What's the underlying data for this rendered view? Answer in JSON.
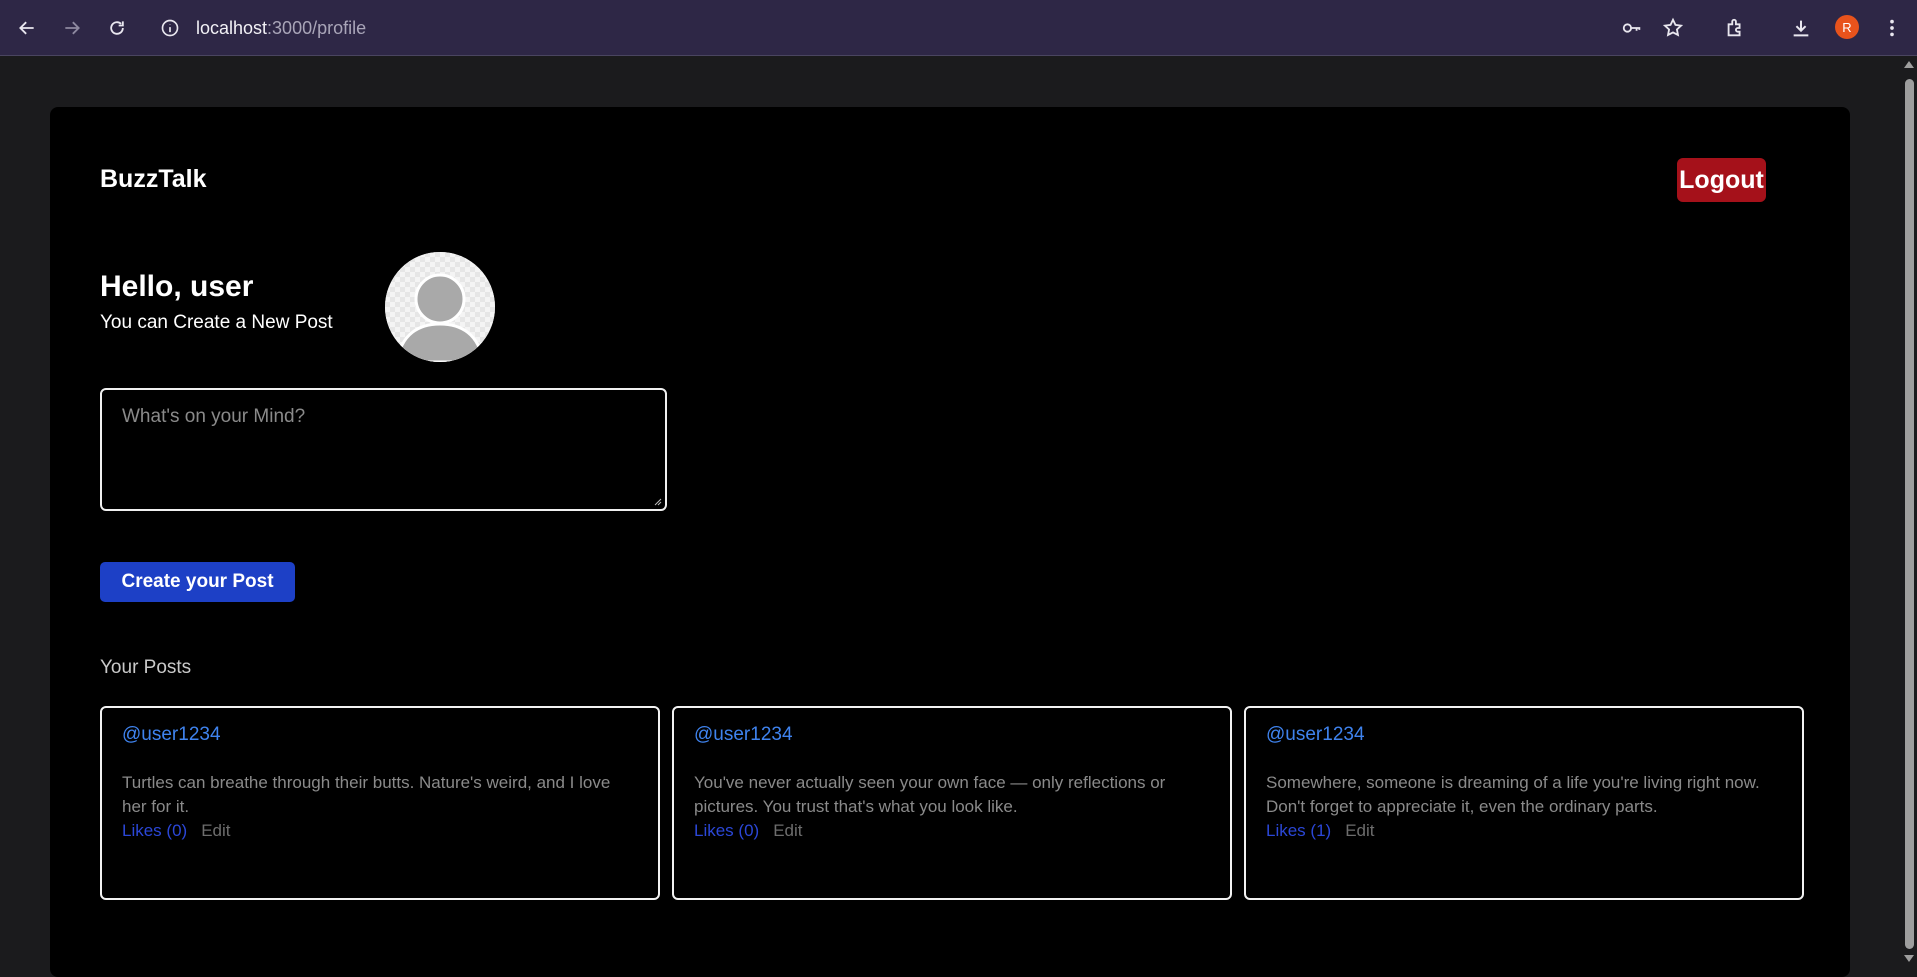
{
  "browser": {
    "url_host": "localhost",
    "url_path": ":3000/profile",
    "profile_initial": "R"
  },
  "header": {
    "brand": "BuzzTalk",
    "logout_label": "Logout"
  },
  "greeting": {
    "title": "Hello, user",
    "subtitle": "You can Create a New Post"
  },
  "composer": {
    "placeholder": "What's on your Mind?",
    "submit_label": "Create your Post"
  },
  "posts_section": {
    "heading": "Your Posts",
    "posts": [
      {
        "username": "@user1234",
        "body": "Turtles can breathe through their butts. Nature's weird, and I love her for it.",
        "likes_label": "Likes (0)",
        "edit_label": "Edit"
      },
      {
        "username": "@user1234",
        "body": "You've never actually seen your own face — only reflections or pictures. You trust that's what you look like.",
        "likes_label": "Likes (0)",
        "edit_label": "Edit"
      },
      {
        "username": "@user1234",
        "body": "Somewhere, someone is dreaming of a life you're living right now. Don't forget to appreciate it, even the ordinary parts.",
        "likes_label": "Likes (1)",
        "edit_label": "Edit"
      }
    ]
  },
  "colors": {
    "page_bg": "#000000",
    "logout": "#a5111a",
    "primary_button": "#1d40c6",
    "username_link": "#3f83ee",
    "likes_link": "#2b47d7"
  }
}
